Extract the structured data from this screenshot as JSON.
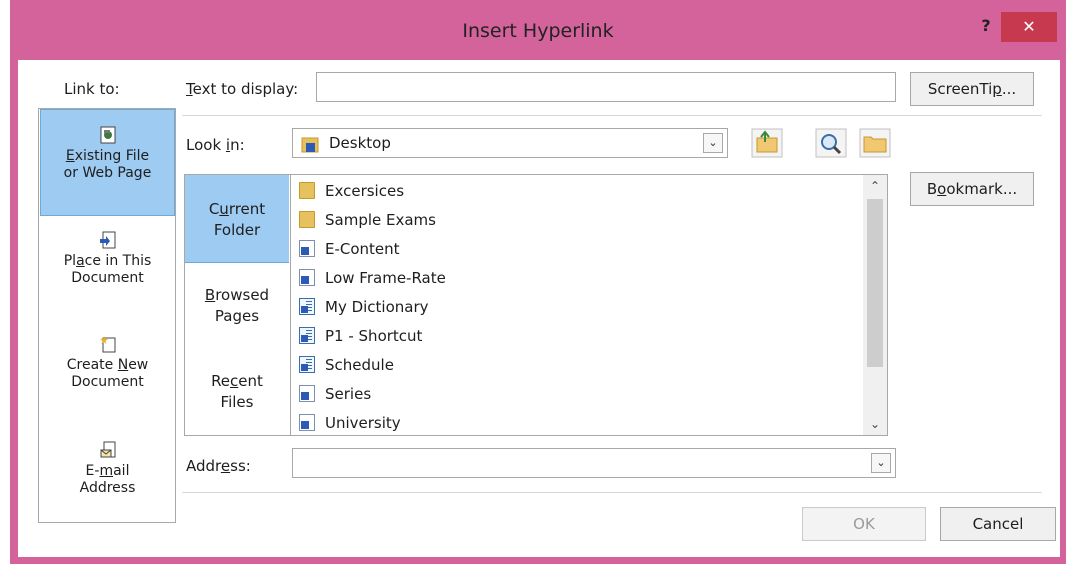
{
  "window": {
    "title": "Insert Hyperlink",
    "help_label": "?",
    "close_label": "✕"
  },
  "link_to": {
    "label": "Link to:",
    "items": [
      {
        "line1_pre": "",
        "line1_u": "E",
        "line1_post": "xisting File",
        "line2": "or Web Page",
        "icon": "existing-file-icon"
      },
      {
        "line1_pre": "Pl",
        "line1_u": "a",
        "line1_post": "ce in This",
        "line2": "Document",
        "icon": "place-in-document-icon"
      },
      {
        "line1_pre": "Create ",
        "line1_u": "N",
        "line1_post": "ew",
        "line2": "Document",
        "icon": "new-document-icon"
      },
      {
        "line1_pre": "E-",
        "line1_u": "m",
        "line1_post": "ail",
        "line2": "Address",
        "icon": "email-address-icon"
      }
    ]
  },
  "text_to_display": {
    "label_u": "T",
    "label_rest": "ext to display:",
    "value": ""
  },
  "screentip": {
    "pre": "ScreenTi",
    "u": "p",
    "post": "..."
  },
  "look_in": {
    "label_pre": "Look ",
    "label_u": "i",
    "label_post": "n:",
    "value": "Desktop"
  },
  "bookmark": {
    "pre": "B",
    "u": "o",
    "post": "okmark..."
  },
  "tabs": [
    {
      "l1_pre": "C",
      "l1_u": "u",
      "l1_post": "rrent",
      "l2": "Folder"
    },
    {
      "l1_pre": "",
      "l1_u": "B",
      "l1_post": "rowsed",
      "l2": "Pages"
    },
    {
      "l1_pre": "Re",
      "l1_u": "c",
      "l1_post": "ent",
      "l2": "Files"
    }
  ],
  "files": [
    {
      "name": "Excersices",
      "type": "folder"
    },
    {
      "name": "Sample Exams",
      "type": "folder"
    },
    {
      "name": "E-Content",
      "type": "shortcut"
    },
    {
      "name": "Low Frame-Rate",
      "type": "shortcut"
    },
    {
      "name": "My Dictionary",
      "type": "doc"
    },
    {
      "name": "P1 - Shortcut",
      "type": "doc"
    },
    {
      "name": "Schedule",
      "type": "doc"
    },
    {
      "name": "Series",
      "type": "shortcut"
    },
    {
      "name": "University",
      "type": "shortcut"
    }
  ],
  "address": {
    "label_pre": "Addr",
    "label_u": "e",
    "label_post": "ss:",
    "value": ""
  },
  "buttons": {
    "ok": "OK",
    "cancel": "Cancel"
  },
  "colors": {
    "title_bar": "#d3639a",
    "close_button": "#c7394f",
    "selection": "#9ecbf2"
  }
}
